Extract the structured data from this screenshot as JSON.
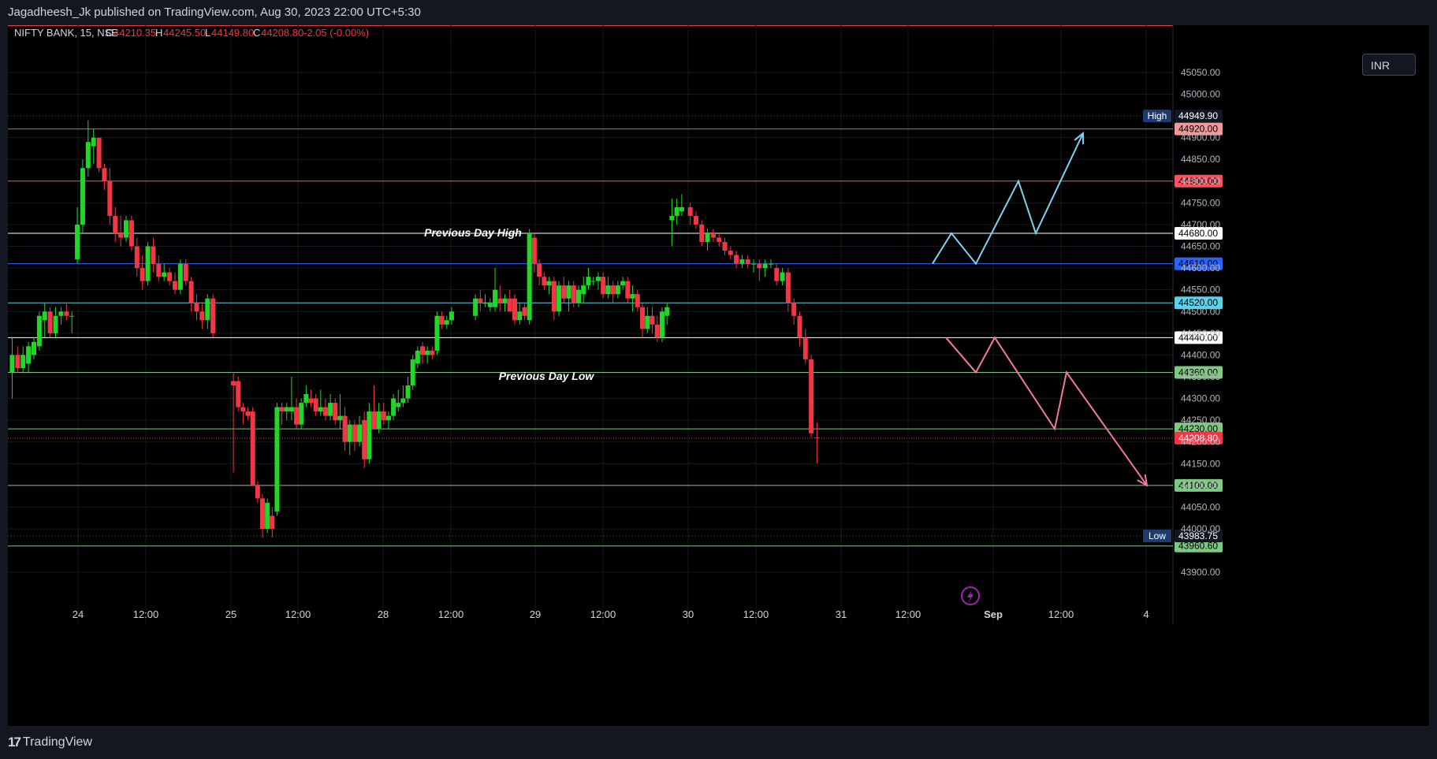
{
  "header": {
    "publisher": "Jagadheesh_Jk published on TradingView.com, Aug 30, 2023 22:00 UTC+5:30"
  },
  "footer": {
    "brand": "TradingView"
  },
  "legend": {
    "symbol": "NIFTY BANK, 15, NSE",
    "open_label": "O",
    "open": "44210.35",
    "high_label": "H",
    "high": "44245.50",
    "low_label": "L",
    "low": "44149.80",
    "close_label": "C",
    "close": "44208.80",
    "change": "-2.05 (-0.00%)"
  },
  "currency": "INR",
  "colors": {
    "up": "#22d628",
    "down": "#f23645",
    "background": "#000000",
    "frame": "#131722"
  },
  "chart_data": {
    "type": "candlestick",
    "ylim": [
      43850,
      45100
    ],
    "y_ticks": [
      43900,
      44000,
      44050,
      44100,
      44150,
      44200,
      44250,
      44300,
      44350,
      44400,
      44450,
      44500,
      44550,
      44600,
      44650,
      44700,
      44750,
      44800,
      44850,
      44900,
      45000,
      45050
    ],
    "y_tick_labels": [
      "43900.00",
      "44000.00",
      "44050.00",
      "44100.00",
      "44150.00",
      "44200.00",
      "44250.00",
      "44300.00",
      "44350.00",
      "44400.00",
      "44450.00",
      "44500.00",
      "44550.00",
      "44600.00",
      "44650.00",
      "44700.00",
      "44750.00",
      "44800.00",
      "44850.00",
      "44900.00",
      "45000.00",
      "45050.00"
    ],
    "x_ticks": [
      "24",
      "12:00",
      "25",
      "12:00",
      "28",
      "12:00",
      "29",
      "12:00",
      "30",
      "12:00",
      "31",
      "12:00",
      "Sep",
      "12:00",
      "4"
    ],
    "levels": [
      {
        "value": 44920.0,
        "label": "44920.00",
        "color": "#ef9a9a",
        "line": "#f7525f"
      },
      {
        "value": 44800.0,
        "label": "44800.00",
        "color": "#f7525f",
        "line": "#f7525f"
      },
      {
        "value": 44680.0,
        "label": "44680.00",
        "color": "#ffffff",
        "line": "#ffffff"
      },
      {
        "value": 44610.0,
        "label": "44610.00",
        "color": "#2962ff",
        "line": "#2962ff"
      },
      {
        "value": 44520.0,
        "label": "44520.00",
        "color": "#5ed1e6",
        "line": "#5ed1e6"
      },
      {
        "value": 44440.0,
        "label": "44440.00",
        "color": "#ffffff",
        "line": "#ffffff"
      },
      {
        "value": 44360.0,
        "label": "44360.00",
        "color": "#81c784",
        "line": "#81c784"
      },
      {
        "value": 44230.0,
        "label": "44230.00",
        "color": "#81c784",
        "line": "#81c784"
      },
      {
        "value": 44100.0,
        "label": "44100.00",
        "color": "#81c784",
        "line": "#81c784"
      },
      {
        "value": 43960.6,
        "label": "43960.60",
        "color": "#81c784",
        "line": "#81c784"
      }
    ],
    "markers": {
      "high": {
        "value": 44949.9,
        "tag": "High",
        "label": "44949.90"
      },
      "low": {
        "value": 43983.75,
        "tag": "Low",
        "label": "43983.75"
      },
      "last": {
        "value": 44208.8,
        "label": "44208.80"
      }
    },
    "annotations": [
      {
        "text": "Previous Day High"
      },
      {
        "text": "Previous Day Low"
      }
    ],
    "candles": [
      {
        "o": 44360,
        "h": 44440,
        "l": 44300,
        "c": 44400
      },
      {
        "o": 44400,
        "h": 44420,
        "l": 44360,
        "c": 44370
      },
      {
        "o": 44370,
        "h": 44420,
        "l": 44360,
        "c": 44400
      },
      {
        "o": 44380,
        "h": 44430,
        "l": 44360,
        "c": 44420
      },
      {
        "o": 44400,
        "h": 44440,
        "l": 44390,
        "c": 44430
      },
      {
        "o": 44420,
        "h": 44500,
        "l": 44410,
        "c": 44490
      },
      {
        "o": 44480,
        "h": 44520,
        "l": 44440,
        "c": 44500
      },
      {
        "o": 44500,
        "h": 44510,
        "l": 44440,
        "c": 44450
      },
      {
        "o": 44450,
        "h": 44510,
        "l": 44440,
        "c": 44490
      },
      {
        "o": 44490,
        "h": 44510,
        "l": 44470,
        "c": 44500
      },
      {
        "o": 44500,
        "h": 44520,
        "l": 44480,
        "c": 44490
      },
      {
        "o": 44490,
        "h": 44500,
        "l": 44450,
        "c": 44490
      },
      {
        "o": 44620,
        "h": 44740,
        "l": 44610,
        "c": 44700
      },
      {
        "o": 44700,
        "h": 44850,
        "l": 44680,
        "c": 44830
      },
      {
        "o": 44830,
        "h": 44940,
        "l": 44810,
        "c": 44890
      },
      {
        "o": 44880,
        "h": 44920,
        "l": 44840,
        "c": 44900
      },
      {
        "o": 44900,
        "h": 44900,
        "l": 44820,
        "c": 44830
      },
      {
        "o": 44830,
        "h": 44840,
        "l": 44780,
        "c": 44800
      },
      {
        "o": 44800,
        "h": 44830,
        "l": 44700,
        "c": 44720
      },
      {
        "o": 44720,
        "h": 44740,
        "l": 44660,
        "c": 44680
      },
      {
        "o": 44680,
        "h": 44720,
        "l": 44650,
        "c": 44670
      },
      {
        "o": 44670,
        "h": 44720,
        "l": 44660,
        "c": 44710
      },
      {
        "o": 44710,
        "h": 44720,
        "l": 44640,
        "c": 44650
      },
      {
        "o": 44650,
        "h": 44670,
        "l": 44580,
        "c": 44600
      },
      {
        "o": 44600,
        "h": 44630,
        "l": 44550,
        "c": 44570
      },
      {
        "o": 44570,
        "h": 44660,
        "l": 44560,
        "c": 44650
      },
      {
        "o": 44650,
        "h": 44670,
        "l": 44590,
        "c": 44610
      },
      {
        "o": 44610,
        "h": 44630,
        "l": 44570,
        "c": 44580
      },
      {
        "o": 44580,
        "h": 44610,
        "l": 44570,
        "c": 44590
      },
      {
        "o": 44590,
        "h": 44600,
        "l": 44560,
        "c": 44570
      },
      {
        "o": 44570,
        "h": 44590,
        "l": 44540,
        "c": 44550
      },
      {
        "o": 44550,
        "h": 44620,
        "l": 44540,
        "c": 44610
      },
      {
        "o": 44610,
        "h": 44620,
        "l": 44560,
        "c": 44570
      },
      {
        "o": 44570,
        "h": 44580,
        "l": 44500,
        "c": 44520
      },
      {
        "o": 44520,
        "h": 44540,
        "l": 44480,
        "c": 44500
      },
      {
        "o": 44500,
        "h": 44520,
        "l": 44460,
        "c": 44480
      },
      {
        "o": 44480,
        "h": 44540,
        "l": 44460,
        "c": 44530
      },
      {
        "o": 44530,
        "h": 44540,
        "l": 44440,
        "c": 44450
      },
      {
        "o": 44340,
        "h": 44360,
        "l": 44130,
        "c": 44330
      },
      {
        "o": 44340,
        "h": 44350,
        "l": 44270,
        "c": 44280
      },
      {
        "o": 44280,
        "h": 44290,
        "l": 44240,
        "c": 44270
      },
      {
        "o": 44270,
        "h": 44280,
        "l": 44250,
        "c": 44260
      },
      {
        "o": 44270,
        "h": 44280,
        "l": 44100,
        "c": 44100
      },
      {
        "o": 44100,
        "h": 44110,
        "l": 44060,
        "c": 44070
      },
      {
        "o": 44070,
        "h": 44080,
        "l": 43980,
        "c": 44000
      },
      {
        "o": 44000,
        "h": 44070,
        "l": 43990,
        "c": 44060
      },
      {
        "o": 44030,
        "h": 44050,
        "l": 43980,
        "c": 44000
      },
      {
        "o": 44040,
        "h": 44290,
        "l": 44030,
        "c": 44280
      },
      {
        "o": 44280,
        "h": 44290,
        "l": 44240,
        "c": 44270
      },
      {
        "o": 44270,
        "h": 44290,
        "l": 44250,
        "c": 44280
      },
      {
        "o": 44270,
        "h": 44350,
        "l": 44250,
        "c": 44280
      },
      {
        "o": 44280,
        "h": 44300,
        "l": 44230,
        "c": 44240
      },
      {
        "o": 44240,
        "h": 44300,
        "l": 44230,
        "c": 44290
      },
      {
        "o": 44290,
        "h": 44330,
        "l": 44280,
        "c": 44310
      },
      {
        "o": 44300,
        "h": 44320,
        "l": 44280,
        "c": 44290
      },
      {
        "o": 44300,
        "h": 44310,
        "l": 44260,
        "c": 44270
      },
      {
        "o": 44270,
        "h": 44320,
        "l": 44260,
        "c": 44280
      },
      {
        "o": 44280,
        "h": 44300,
        "l": 44250,
        "c": 44260
      },
      {
        "o": 44260,
        "h": 44310,
        "l": 44250,
        "c": 44290
      },
      {
        "o": 44290,
        "h": 44300,
        "l": 44240,
        "c": 44250
      },
      {
        "o": 44250,
        "h": 44310,
        "l": 44230,
        "c": 44260
      },
      {
        "o": 44260,
        "h": 44280,
        "l": 44180,
        "c": 44200
      },
      {
        "o": 44200,
        "h": 44250,
        "l": 44170,
        "c": 44240
      },
      {
        "o": 44240,
        "h": 44250,
        "l": 44180,
        "c": 44200
      },
      {
        "o": 44200,
        "h": 44260,
        "l": 44190,
        "c": 44240
      },
      {
        "o": 44250,
        "h": 44270,
        "l": 44140,
        "c": 44160
      },
      {
        "o": 44160,
        "h": 44290,
        "l": 44150,
        "c": 44270
      },
      {
        "o": 44270,
        "h": 44330,
        "l": 44240,
        "c": 44230
      },
      {
        "o": 44230,
        "h": 44290,
        "l": 44220,
        "c": 44270
      },
      {
        "o": 44270,
        "h": 44290,
        "l": 44240,
        "c": 44250
      },
      {
        "o": 44250,
        "h": 44270,
        "l": 44230,
        "c": 44260
      },
      {
        "o": 44260,
        "h": 44310,
        "l": 44250,
        "c": 44300
      },
      {
        "o": 44280,
        "h": 44320,
        "l": 44270,
        "c": 44290
      },
      {
        "o": 44290,
        "h": 44330,
        "l": 44280,
        "c": 44300
      },
      {
        "o": 44300,
        "h": 44350,
        "l": 44290,
        "c": 44330
      },
      {
        "o": 44330,
        "h": 44400,
        "l": 44320,
        "c": 44390
      },
      {
        "o": 44380,
        "h": 44420,
        "l": 44370,
        "c": 44410
      },
      {
        "o": 44420,
        "h": 44430,
        "l": 44380,
        "c": 44400
      },
      {
        "o": 44400,
        "h": 44420,
        "l": 44380,
        "c": 44410
      },
      {
        "o": 44410,
        "h": 44420,
        "l": 44390,
        "c": 44400
      },
      {
        "o": 44410,
        "h": 44500,
        "l": 44400,
        "c": 44490
      },
      {
        "o": 44490,
        "h": 44500,
        "l": 44460,
        "c": 44470
      },
      {
        "o": 44470,
        "h": 44490,
        "l": 44460,
        "c": 44480
      },
      {
        "o": 44480,
        "h": 44510,
        "l": 44470,
        "c": 44500
      },
      {
        "o": 44490,
        "h": 44540,
        "l": 44480,
        "c": 44530
      },
      {
        "o": 44530,
        "h": 44550,
        "l": 44500,
        "c": 44520
      },
      {
        "o": 44520,
        "h": 44540,
        "l": 44510,
        "c": 44520
      },
      {
        "o": 44510,
        "h": 44530,
        "l": 44500,
        "c": 44520
      },
      {
        "o": 44510,
        "h": 44600,
        "l": 44500,
        "c": 44550
      },
      {
        "o": 44530,
        "h": 44560,
        "l": 44500,
        "c": 44520
      },
      {
        "o": 44520,
        "h": 44540,
        "l": 44500,
        "c": 44530
      },
      {
        "o": 44530,
        "h": 44550,
        "l": 44510,
        "c": 44500
      },
      {
        "o": 44530,
        "h": 44540,
        "l": 44470,
        "c": 44480
      },
      {
        "o": 44480,
        "h": 44520,
        "l": 44470,
        "c": 44500
      },
      {
        "o": 44510,
        "h": 44520,
        "l": 44480,
        "c": 44490
      },
      {
        "o": 44480,
        "h": 44690,
        "l": 44470,
        "c": 44680
      },
      {
        "o": 44670,
        "h": 44680,
        "l": 44590,
        "c": 44610
      },
      {
        "o": 44610,
        "h": 44620,
        "l": 44560,
        "c": 44580
      },
      {
        "o": 44580,
        "h": 44590,
        "l": 44550,
        "c": 44560
      },
      {
        "o": 44560,
        "h": 44580,
        "l": 44540,
        "c": 44570
      },
      {
        "o": 44570,
        "h": 44580,
        "l": 44480,
        "c": 44500
      },
      {
        "o": 44500,
        "h": 44570,
        "l": 44490,
        "c": 44560
      },
      {
        "o": 44560,
        "h": 44580,
        "l": 44520,
        "c": 44530
      },
      {
        "o": 44530,
        "h": 44570,
        "l": 44500,
        "c": 44560
      },
      {
        "o": 44560,
        "h": 44570,
        "l": 44510,
        "c": 44520
      },
      {
        "o": 44520,
        "h": 44560,
        "l": 44510,
        "c": 44550
      },
      {
        "o": 44540,
        "h": 44580,
        "l": 44520,
        "c": 44560
      },
      {
        "o": 44560,
        "h": 44600,
        "l": 44550,
        "c": 44580
      },
      {
        "o": 44570,
        "h": 44580,
        "l": 44560,
        "c": 44570
      },
      {
        "o": 44570,
        "h": 44590,
        "l": 44550,
        "c": 44580
      },
      {
        "o": 44580,
        "h": 44590,
        "l": 44530,
        "c": 44540
      },
      {
        "o": 44540,
        "h": 44580,
        "l": 44530,
        "c": 44560
      },
      {
        "o": 44560,
        "h": 44570,
        "l": 44520,
        "c": 44540
      },
      {
        "o": 44540,
        "h": 44570,
        "l": 44530,
        "c": 44560
      },
      {
        "o": 44560,
        "h": 44580,
        "l": 44550,
        "c": 44570
      },
      {
        "o": 44570,
        "h": 44580,
        "l": 44520,
        "c": 44530
      },
      {
        "o": 44530,
        "h": 44560,
        "l": 44500,
        "c": 44540
      },
      {
        "o": 44540,
        "h": 44550,
        "l": 44500,
        "c": 44510
      },
      {
        "o": 44510,
        "h": 44520,
        "l": 44440,
        "c": 44460
      },
      {
        "o": 44460,
        "h": 44510,
        "l": 44450,
        "c": 44490
      },
      {
        "o": 44490,
        "h": 44510,
        "l": 44450,
        "c": 44470
      },
      {
        "o": 44470,
        "h": 44490,
        "l": 44430,
        "c": 44440
      },
      {
        "o": 44440,
        "h": 44510,
        "l": 44430,
        "c": 44500
      },
      {
        "o": 44490,
        "h": 44520,
        "l": 44470,
        "c": 44510
      },
      {
        "o": 44710,
        "h": 44760,
        "l": 44650,
        "c": 44720
      },
      {
        "o": 44720,
        "h": 44760,
        "l": 44700,
        "c": 44740
      },
      {
        "o": 44730,
        "h": 44770,
        "l": 44720,
        "c": 44740
      },
      {
        "o": 44740,
        "h": 44750,
        "l": 44700,
        "c": 44720
      },
      {
        "o": 44720,
        "h": 44730,
        "l": 44690,
        "c": 44700
      },
      {
        "o": 44700,
        "h": 44710,
        "l": 44650,
        "c": 44660
      },
      {
        "o": 44660,
        "h": 44690,
        "l": 44640,
        "c": 44680
      },
      {
        "o": 44680,
        "h": 44690,
        "l": 44660,
        "c": 44670
      },
      {
        "o": 44670,
        "h": 44680,
        "l": 44650,
        "c": 44660
      },
      {
        "o": 44660,
        "h": 44670,
        "l": 44630,
        "c": 44640
      },
      {
        "o": 44640,
        "h": 44650,
        "l": 44620,
        "c": 44630
      },
      {
        "o": 44630,
        "h": 44640,
        "l": 44600,
        "c": 44610
      },
      {
        "o": 44610,
        "h": 44630,
        "l": 44600,
        "c": 44620
      },
      {
        "o": 44620,
        "h": 44630,
        "l": 44600,
        "c": 44610
      },
      {
        "o": 44610,
        "h": 44620,
        "l": 44590,
        "c": 44610
      },
      {
        "o": 44610,
        "h": 44620,
        "l": 44570,
        "c": 44600
      },
      {
        "o": 44600,
        "h": 44620,
        "l": 44580,
        "c": 44610
      },
      {
        "o": 44610,
        "h": 44620,
        "l": 44600,
        "c": 44610
      },
      {
        "o": 44600,
        "h": 44610,
        "l": 44560,
        "c": 44570
      },
      {
        "o": 44570,
        "h": 44600,
        "l": 44560,
        "c": 44590
      },
      {
        "o": 44590,
        "h": 44600,
        "l": 44500,
        "c": 44520
      },
      {
        "o": 44520,
        "h": 44530,
        "l": 44470,
        "c": 44490
      },
      {
        "o": 44490,
        "h": 44500,
        "l": 44420,
        "c": 44440
      },
      {
        "o": 44440,
        "h": 44460,
        "l": 44380,
        "c": 44390
      },
      {
        "o": 44390,
        "h": 44400,
        "l": 44210,
        "c": 44220
      },
      {
        "o": 44210,
        "h": 44245,
        "l": 44150,
        "c": 44209
      }
    ],
    "projections": [
      {
        "name": "",
        "color": "#7fd3f0",
        "points": [
          [
            0,
            44610
          ],
          [
            1,
            44680
          ],
          [
            2,
            44610
          ],
          [
            3,
            44800
          ],
          [
            4,
            44680
          ],
          [
            5,
            44910
          ]
        ]
      },
      {
        "name": "",
        "color": "#f27aa0",
        "points": [
          [
            0,
            44440
          ],
          [
            1,
            44360
          ],
          [
            2,
            44440
          ],
          [
            3,
            44230
          ],
          [
            4,
            44360
          ],
          [
            5,
            44100
          ]
        ]
      }
    ]
  }
}
